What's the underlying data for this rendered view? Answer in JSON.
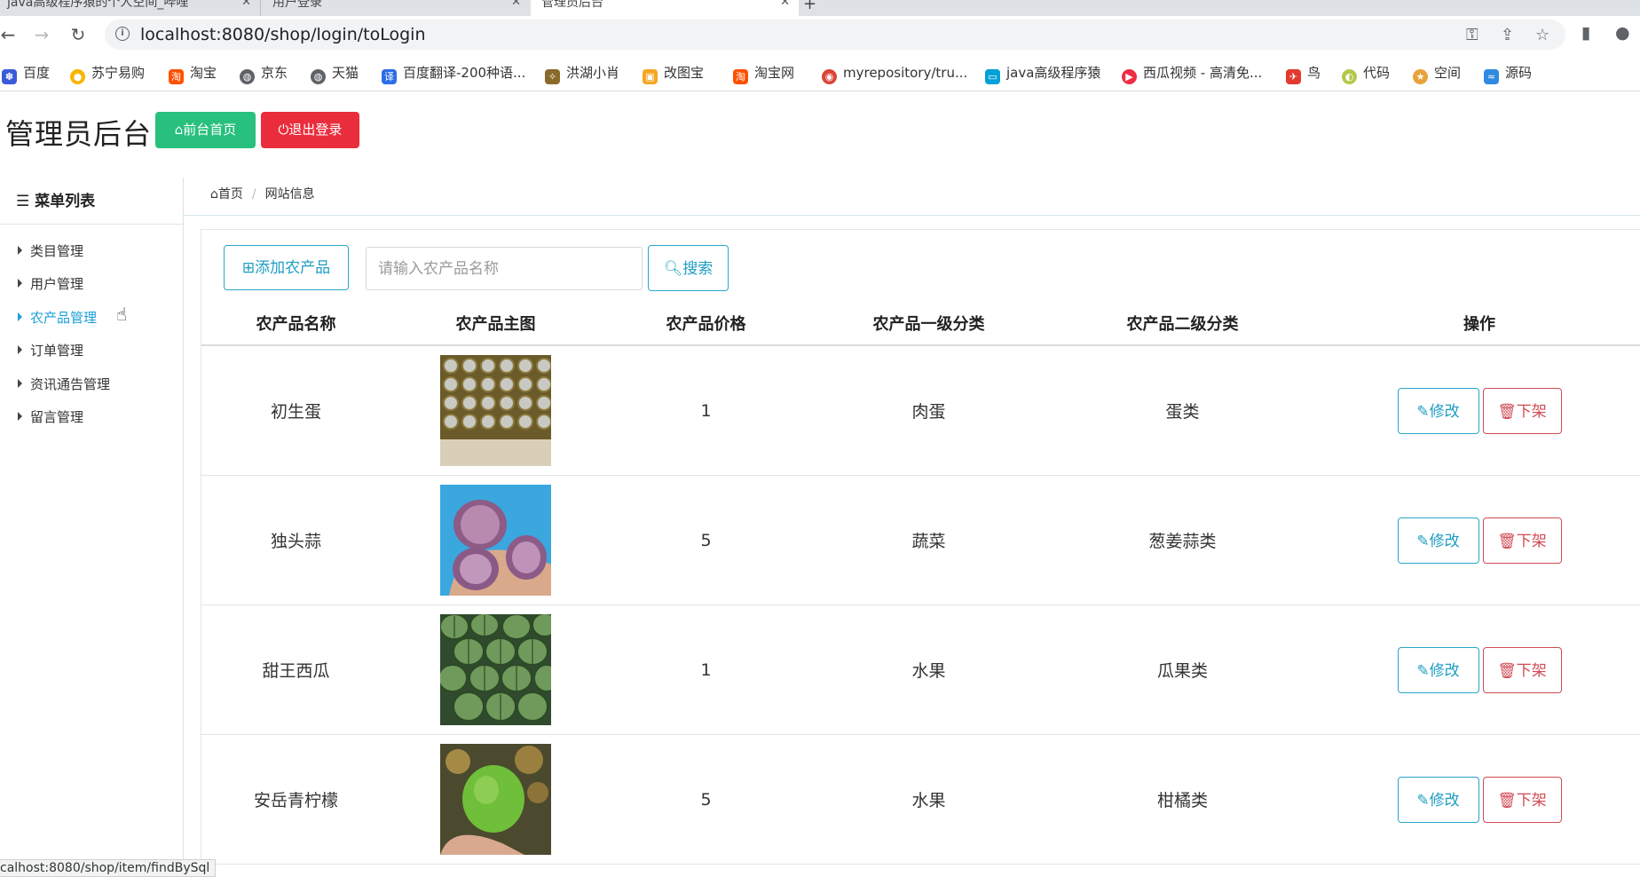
{
  "browser": {
    "tabs": [
      {
        "label": "java高级程序猿的个人空间_哔哩"
      },
      {
        "label": "用户登录"
      },
      {
        "label": "管理员后台"
      }
    ],
    "url": "localhost:8080/shop/login/toLogin",
    "bookmarks": [
      {
        "label": "百度",
        "icon": "baidu-icon",
        "color": "#3a5bd9"
      },
      {
        "label": "苏宁易购",
        "icon": "suning-icon",
        "color": "#f7b500"
      },
      {
        "label": "淘宝",
        "icon": "taobao-icon",
        "color": "#ff5000"
      },
      {
        "label": "京东",
        "icon": "globe-icon",
        "color": "#5f6368"
      },
      {
        "label": "天猫",
        "icon": "globe-icon",
        "color": "#5f6368"
      },
      {
        "label": "百度翻译-200种语...",
        "icon": "translate-icon",
        "color": "#2b6de5"
      },
      {
        "label": "洪湖小肖",
        "icon": "bird-icon",
        "color": "#8a6a2a"
      },
      {
        "label": "改图宝",
        "icon": "image-icon",
        "color": "#f5a623"
      },
      {
        "label": "淘宝网",
        "icon": "taobao-icon",
        "color": "#ff5000"
      },
      {
        "label": "myrepository/tru...",
        "icon": "chrome-icon",
        "color": "#db4437"
      },
      {
        "label": "java高级程序猿",
        "icon": "bilibili-icon",
        "color": "#00a1d6"
      },
      {
        "label": "西瓜视频 - 高清免...",
        "icon": "xigua-icon",
        "color": "#f02d43"
      },
      {
        "label": "鸟",
        "icon": "bird-icon",
        "color": "#e23b2e"
      },
      {
        "label": "代码",
        "icon": "code-icon",
        "color": "#b4c84a"
      },
      {
        "label": "空间",
        "icon": "qzone-icon",
        "color": "#e8a23a"
      },
      {
        "label": "源码",
        "icon": "whale-icon",
        "color": "#2f8be0"
      }
    ],
    "status_url": "calhost:8080/shop/item/findBySql"
  },
  "header": {
    "title": "管理员后台",
    "home_button": "前台首页",
    "logout_button": "退出登录"
  },
  "sidebar": {
    "title": "菜单列表",
    "items": [
      {
        "label": "类目管理"
      },
      {
        "label": "用户管理"
      },
      {
        "label": "农产品管理"
      },
      {
        "label": "订单管理"
      },
      {
        "label": "资讯通告管理"
      },
      {
        "label": "留言管理"
      }
    ]
  },
  "breadcrumb": {
    "home": "首页",
    "current": "网站信息"
  },
  "toolbar": {
    "add_label": "添加农产品",
    "search_placeholder": "请输入农产品名称",
    "search_label": "搜索"
  },
  "table": {
    "headers": [
      "农产品名称",
      "农产品主图",
      "农产品价格",
      "农产品一级分类",
      "农产品二级分类",
      "操作"
    ],
    "edit_label": "修改",
    "remove_label": "下架",
    "rows": [
      {
        "name": "初生蛋",
        "price": "1",
        "cat1": "肉蛋",
        "cat2": "蛋类",
        "image": "eggs-tray"
      },
      {
        "name": "独头蒜",
        "price": "5",
        "cat1": "蔬菜",
        "cat2": "葱姜蒜类",
        "image": "purple-garlic"
      },
      {
        "name": "甜王西瓜",
        "price": "1",
        "cat1": "水果",
        "cat2": "瓜果类",
        "image": "watermelons"
      },
      {
        "name": "安岳青柠檬",
        "price": "5",
        "cat1": "水果",
        "cat2": "柑橘类",
        "image": "green-lemon"
      }
    ]
  },
  "colors": {
    "primary": "#1f9dc3",
    "success": "#27c07d",
    "danger": "#ea2d3c"
  }
}
